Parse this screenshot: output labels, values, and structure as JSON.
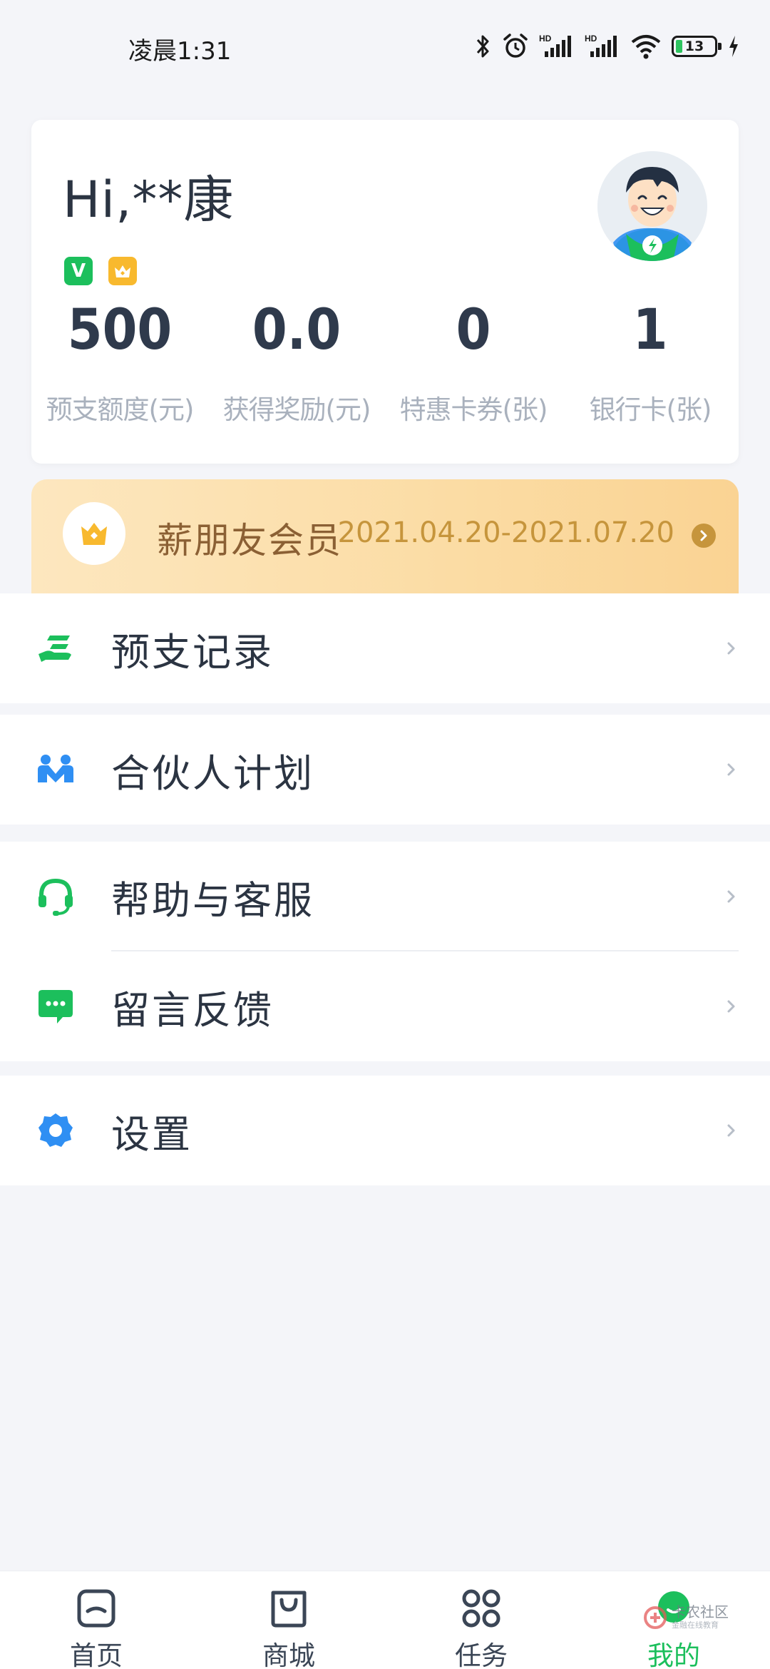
{
  "status_bar": {
    "time": "凌晨1:31",
    "battery": "13",
    "icons": [
      "bluetooth-icon",
      "alarm-icon",
      "hd-signal-icon",
      "hd-signal-icon",
      "wifi-icon",
      "battery-icon",
      "charging-icon"
    ]
  },
  "profile": {
    "greeting": "Hi,**康",
    "badges": [
      "verified-v-badge",
      "crown-badge"
    ],
    "badge_v_text": "V",
    "stats": [
      {
        "value": "500",
        "label": "预支额度(元)"
      },
      {
        "value": "0.0",
        "label": "获得奖励(元)"
      },
      {
        "value": "0",
        "label": "特惠卡券(张)"
      },
      {
        "value": "1",
        "label": "银行卡(张)"
      }
    ]
  },
  "vip": {
    "title": "薪朋友会员",
    "date_range": "2021.04.20-2021.07.20"
  },
  "menu": {
    "advance_records": "预支记录",
    "partner_plan": "合伙人计划",
    "help_service": "帮助与客服",
    "feedback": "留言反馈",
    "settings": "设置"
  },
  "tabs": [
    {
      "label": "首页",
      "icon": "home-icon"
    },
    {
      "label": "商城",
      "icon": "shopping-bag-icon"
    },
    {
      "label": "任务",
      "icon": "grid-icon"
    },
    {
      "label": "我的",
      "icon": "profile-icon",
      "active": true
    }
  ],
  "watermark": {
    "text": "卡农社区",
    "sub": "金融在线教育"
  },
  "colors": {
    "accent_green": "#1cbf5c",
    "gold": "#c6953c",
    "blue": "#2f8ff3",
    "background": "#f4f5f9"
  }
}
